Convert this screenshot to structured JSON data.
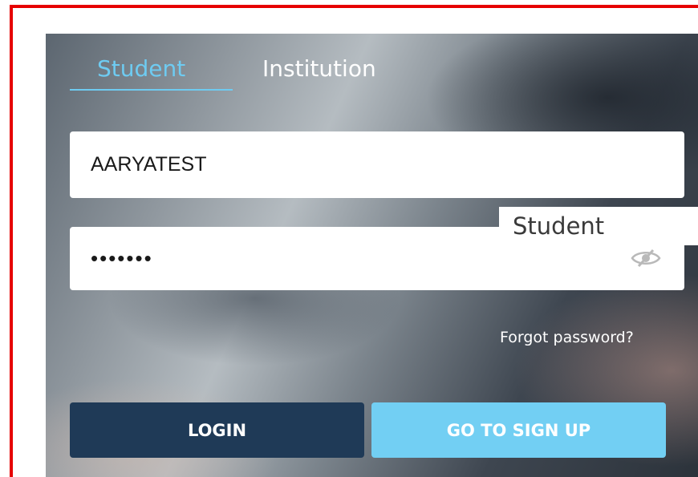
{
  "tabs": {
    "student": "Student",
    "institution": "Institution"
  },
  "login_form": {
    "username_value": "AARYATEST",
    "password_masked": "•••••••",
    "show_password_icon": "eye-slash-icon",
    "forgot_password": "Forgot password?",
    "login_label": "LOGIN",
    "signup_label": "GO TO SIGN UP"
  },
  "tooltip": {
    "text": "Student"
  },
  "colors": {
    "annotation_border": "#e60000",
    "active_tab": "#6ecbf1",
    "login_button": "#1f3a57",
    "signup_button": "#72cff3"
  }
}
